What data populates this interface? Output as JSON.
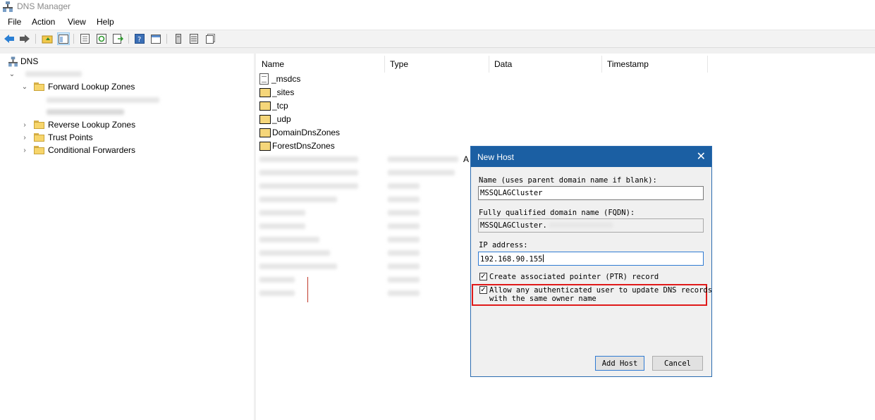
{
  "window": {
    "title": "DNS Manager"
  },
  "menu": [
    "File",
    "Action",
    "View",
    "Help"
  ],
  "toolbar": {
    "icons": [
      "back-arrow-icon",
      "forward-arrow-icon",
      "up-folder-icon",
      "show-hide-tree-icon",
      "properties-icon",
      "refresh-icon",
      "export-list-icon",
      "help-icon",
      "console-icon",
      "server-icon",
      "list-icon",
      "records-icon"
    ]
  },
  "tree": {
    "root": "DNS",
    "forward_zones": "Forward Lookup Zones",
    "reverse_zones": "Reverse Lookup Zones",
    "trust_points": "Trust Points",
    "conditional_forwarders": "Conditional Forwarders"
  },
  "list": {
    "columns": [
      "Name",
      "Type",
      "Data",
      "Timestamp"
    ],
    "rows": [
      "_msdcs",
      "_sites",
      "_tcp",
      "_udp",
      "DomainDnsZones",
      "ForestDnsZones"
    ],
    "partial_data_text": "A"
  },
  "dialog": {
    "title": "New Host",
    "name_label": "Name (uses parent domain name if blank):",
    "name_value": "MSSQLAGCluster",
    "fqdn_label": "Fully qualified domain name (FQDN):",
    "fqdn_value": "MSSQLAGCluster.",
    "ip_label": "IP address:",
    "ip_value": "192.168.90.155",
    "ptr_label": "Create associated pointer (PTR) record",
    "ptr_checked": true,
    "allow_label_line1": "Allow any authenticated user to update DNS records",
    "allow_label_line2": "with the same owner name",
    "allow_checked": true,
    "add_host_button": "Add Host",
    "cancel_button": "Cancel"
  },
  "colors": {
    "dialog_title_bar": "#1b5fa3",
    "highlight_border": "#e01a1a",
    "folder": "#f7d56b"
  }
}
